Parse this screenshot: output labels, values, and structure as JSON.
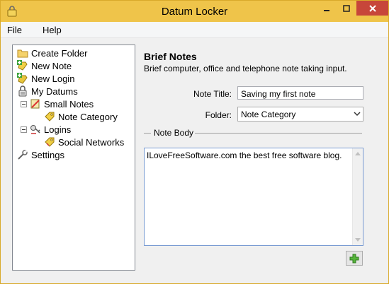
{
  "window": {
    "title": "Datum Locker"
  },
  "menu": {
    "items": [
      {
        "label": "File"
      },
      {
        "label": "Help"
      }
    ]
  },
  "tree": {
    "nodes": [
      {
        "label": "Create Folder",
        "icon": "folder-icon"
      },
      {
        "label": "New Note",
        "icon": "new-note-icon"
      },
      {
        "label": "New Login",
        "icon": "new-login-icon"
      },
      {
        "label": "My Datums",
        "icon": "datum-icon"
      },
      {
        "label": "Small Notes",
        "icon": "notes-icon",
        "expanded": true
      },
      {
        "label": "Note Category",
        "icon": "tag-icon"
      },
      {
        "label": "Logins",
        "icon": "logins-icon",
        "expanded": true
      },
      {
        "label": "Social Networks",
        "icon": "tag-icon"
      },
      {
        "label": "Settings",
        "icon": "settings-icon"
      }
    ]
  },
  "content": {
    "title": "Brief Notes",
    "description": "Brief computer, office and telephone note taking input.",
    "note_title_label": "Note Title:",
    "note_title_value": "Saving my first note",
    "folder_label": "Folder:",
    "folder_value": "Note Category",
    "note_body_label": "Note Body",
    "note_body_value": "ILoveFreeSoftware.com the best free software blog."
  },
  "colors": {
    "titlebar": "#efc44a",
    "close": "#c7463a",
    "accent": "#7a9cd3"
  }
}
